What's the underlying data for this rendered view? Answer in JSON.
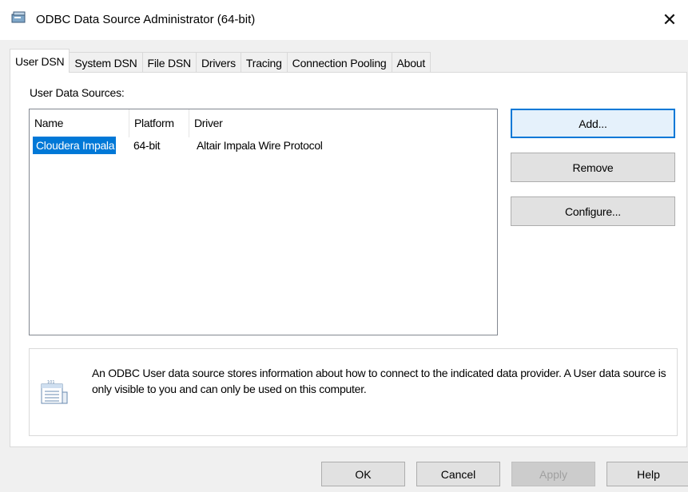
{
  "window": {
    "title": "ODBC Data Source Administrator (64-bit)",
    "close_label": "✕",
    "app_icon": "odbc-admin-icon"
  },
  "tabs": [
    {
      "label": "User DSN",
      "active": true
    },
    {
      "label": "System DSN"
    },
    {
      "label": "File DSN"
    },
    {
      "label": "Drivers"
    },
    {
      "label": "Tracing"
    },
    {
      "label": "Connection Pooling"
    },
    {
      "label": "About"
    }
  ],
  "user_dsn": {
    "section_label": "User Data Sources:",
    "columns": [
      "Name",
      "Platform",
      "Driver"
    ],
    "rows": [
      {
        "name": "Cloudera Impala",
        "platform": "64-bit",
        "driver": "Altair Impala Wire Protocol",
        "selected": true
      }
    ],
    "buttons": {
      "add": "Add...",
      "remove": "Remove",
      "configure": "Configure..."
    },
    "info_text": "An ODBC User data source stores information about how to connect to the indicated data provider.  A User data source is only visible to you and can only be used on this computer.",
    "info_icon": "data-source-icon"
  },
  "footer": {
    "ok": "OK",
    "cancel": "Cancel",
    "apply": "Apply",
    "help": "Help"
  },
  "colors": {
    "selection": "#0078d7",
    "default_button_border": "#0078d7"
  }
}
